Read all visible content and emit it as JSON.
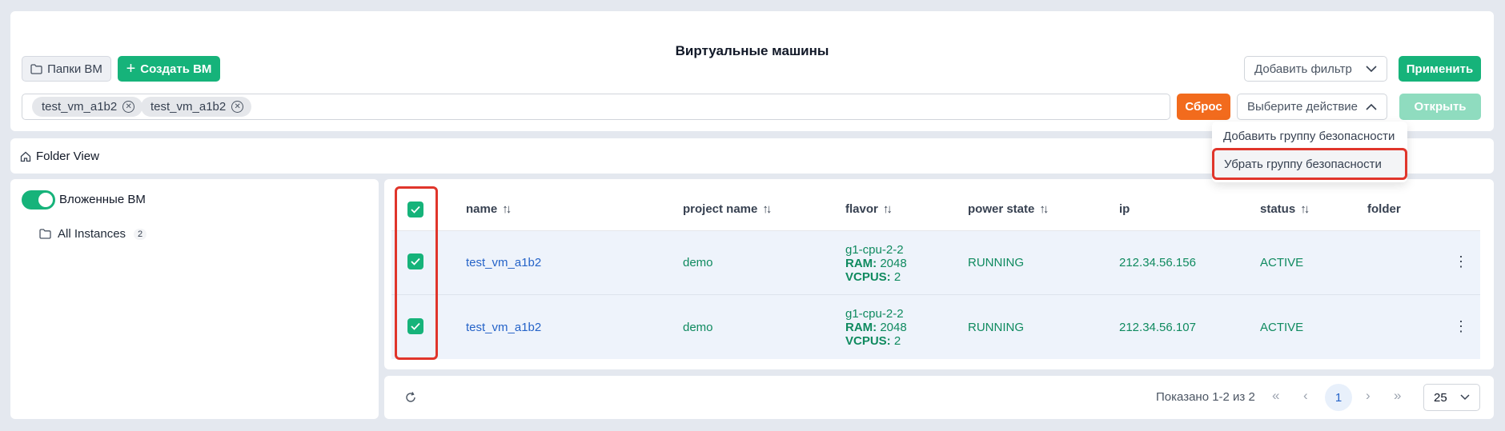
{
  "header": {
    "title": "Виртуальные машины",
    "folders_button": "Папки ВМ",
    "create_button": "Создать ВМ",
    "add_filter_placeholder": "Добавить фильтр",
    "apply_button": "Применить"
  },
  "filter_bar": {
    "chips": [
      "test_vm_a1b2",
      "test_vm_a1b2"
    ],
    "reset_button": "Сброс",
    "action_placeholder": "Выберите действие",
    "open_button": "Открыть"
  },
  "action_menu": {
    "items": [
      "Добавить группу безопасности",
      "Убрать группу безопасности"
    ],
    "highlighted_index": 1
  },
  "folder_view": {
    "label": "Folder View"
  },
  "sidebar": {
    "toggle_label": "Вложенные ВМ",
    "toggle_on": true,
    "folder_label": "All Instances",
    "folder_count": "2"
  },
  "table": {
    "columns": [
      "name",
      "project name",
      "flavor",
      "power state",
      "ip",
      "status",
      "folder"
    ],
    "rows": [
      {
        "name": "test_vm_a1b2",
        "project": "demo",
        "flavor_name": "g1-cpu-2-2",
        "ram_label": "RAM:",
        "ram_value": "2048",
        "vcpus_label": "VCPUS:",
        "vcpus_value": "2",
        "power_state": "RUNNING",
        "ip": "212.34.56.156",
        "status": "ACTIVE",
        "folder": "",
        "checked": true
      },
      {
        "name": "test_vm_a1b2",
        "project": "demo",
        "flavor_name": "g1-cpu-2-2",
        "ram_label": "RAM:",
        "ram_value": "2048",
        "vcpus_label": "VCPUS:",
        "vcpus_value": "2",
        "power_state": "RUNNING",
        "ip": "212.34.56.107",
        "status": "ACTIVE",
        "folder": "",
        "checked": true
      }
    ]
  },
  "pagination": {
    "summary": "Показано 1-2 из 2",
    "current_page": "1",
    "page_size": "25"
  },
  "colors": {
    "accent_green": "#16b37a",
    "reset_orange": "#f26b1d",
    "highlight_red": "#e0352b",
    "link_blue": "#2563c8"
  }
}
